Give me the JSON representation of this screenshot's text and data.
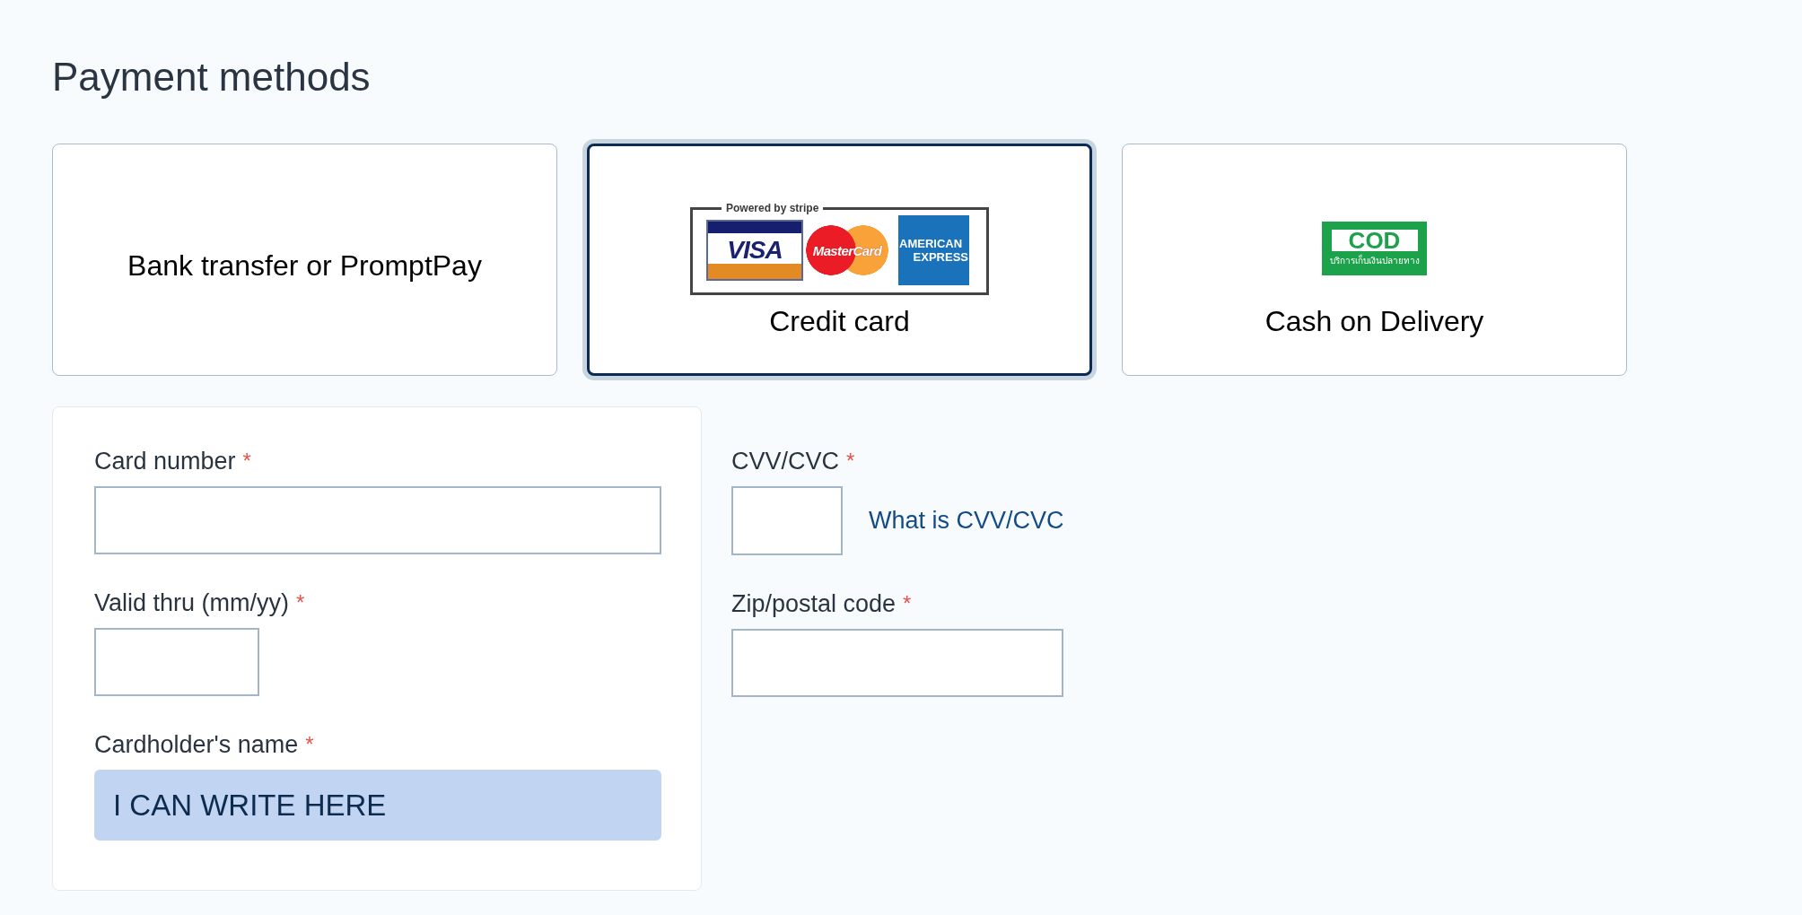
{
  "title": "Payment methods",
  "methods": [
    {
      "kind": "text",
      "label": "Bank transfer or PromptPay",
      "selected": false
    },
    {
      "kind": "cards",
      "label": "Credit card",
      "selected": true,
      "logo": {
        "caption": "Powered by **stripe**",
        "brands": [
          {
            "kind": "visa",
            "label": "VISA"
          },
          {
            "kind": "mastercard",
            "label": "MasterCard"
          },
          {
            "kind": "amex",
            "lines": [
              "AMERICAN",
              "EXPRESS"
            ]
          }
        ]
      }
    },
    {
      "kind": "cod",
      "label": "Cash on Delivery",
      "selected": false,
      "logo": {
        "title": "COD",
        "subtitle": "บริการเก็บเงินปลายทาง"
      }
    }
  ],
  "card_form": {
    "card_number": {
      "label": "Card number",
      "required_mark": "*",
      "highlighted": false
    },
    "valid_thru": {
      "label": "Valid thru (mm/yy)",
      "required_mark": "*",
      "highlighted": false
    },
    "cardholder_name": {
      "label": "Cardholder's name",
      "required_mark": "*",
      "highlighted": true,
      "value": "I CAN WRITE HERE"
    }
  },
  "side_fields": {
    "cvv": {
      "label": "CVV/CVC",
      "required_mark": "*",
      "highlighted": false,
      "help_link": "What is CVV/CVC"
    },
    "zip": {
      "label": "Zip/postal code",
      "required_mark": "*",
      "highlighted": false
    }
  }
}
